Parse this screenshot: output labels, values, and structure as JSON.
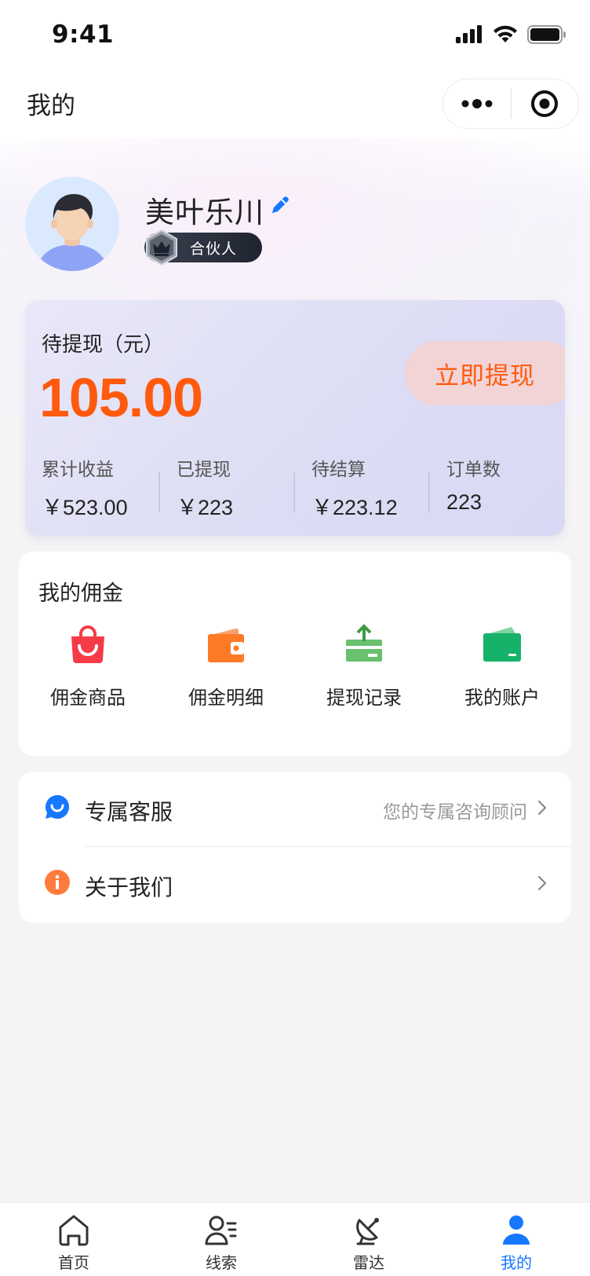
{
  "status_bar": {
    "time": "9:41"
  },
  "nav": {
    "title": "我的",
    "more_icon": "more-dots-icon",
    "close_icon": "target-circle-icon"
  },
  "profile": {
    "name": "美叶乐川",
    "badge": "合伙人"
  },
  "earnings": {
    "label": "待提现（元）",
    "amount": "105.00",
    "withdraw_label": "立即提现",
    "stats": [
      {
        "label": "累计收益",
        "value": "￥523.00"
      },
      {
        "label": "已提现",
        "value": "￥223"
      },
      {
        "label": "待结算",
        "value": "￥223.12"
      },
      {
        "label": "订单数",
        "value": "223"
      }
    ]
  },
  "commission": {
    "title": "我的佣金",
    "items": [
      {
        "label": "佣金商品",
        "icon": "shopping-bag-icon"
      },
      {
        "label": "佣金明细",
        "icon": "wallet-icon"
      },
      {
        "label": "提现记录",
        "icon": "withdraw-upload-icon"
      },
      {
        "label": "我的账户",
        "icon": "account-card-icon"
      }
    ]
  },
  "menu": {
    "items": [
      {
        "label": "专属客服",
        "hint": "您的专属咨询顾问",
        "icon": "customer-service-icon"
      },
      {
        "label": "关于我们",
        "hint": "",
        "icon": "info-icon"
      }
    ]
  },
  "tabs": [
    {
      "label": "首页",
      "icon": "home-icon"
    },
    {
      "label": "线索",
      "icon": "contacts-icon"
    },
    {
      "label": "雷达",
      "icon": "radar-icon"
    },
    {
      "label": "我的",
      "icon": "user-icon",
      "active": true
    }
  ],
  "colors": {
    "accent": "#1677ff",
    "amount": "#ff5a0e",
    "badge_bg": "#2a2f3b"
  }
}
